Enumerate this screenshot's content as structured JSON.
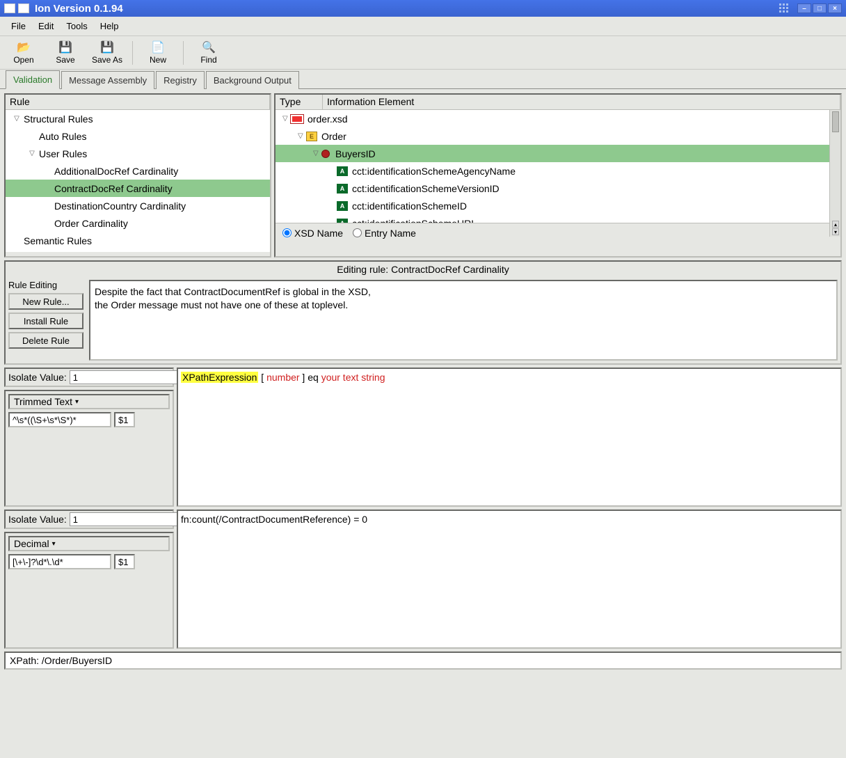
{
  "window": {
    "title": "Ion Version 0.1.94"
  },
  "menu": {
    "file": "File",
    "edit": "Edit",
    "tools": "Tools",
    "help": "Help"
  },
  "toolbar": {
    "open": "Open",
    "save": "Save",
    "saveas": "Save As",
    "new": "New",
    "find": "Find"
  },
  "tabs": [
    "Validation",
    "Message Assembly",
    "Registry",
    "Background Output"
  ],
  "rules": {
    "header": "Rule",
    "items": [
      {
        "label": "Structural Rules",
        "depth": 0,
        "expanded": true
      },
      {
        "label": "Auto Rules",
        "depth": 1
      },
      {
        "label": "User Rules",
        "depth": 1,
        "expanded": true
      },
      {
        "label": "AdditionalDocRef Cardinality",
        "depth": 2
      },
      {
        "label": "ContractDocRef Cardinality",
        "depth": 2,
        "selected": true
      },
      {
        "label": "DestinationCountry Cardinality",
        "depth": 2
      },
      {
        "label": "Order Cardinality",
        "depth": 2
      },
      {
        "label": "Semantic Rules",
        "depth": 0
      }
    ]
  },
  "types": {
    "type_header": "Type",
    "info_header": "Information Element",
    "items": [
      {
        "label": "order.xsd",
        "depth": 0,
        "expanded": true,
        "icon": "file"
      },
      {
        "label": "Order",
        "depth": 1,
        "expanded": true,
        "icon": "E"
      },
      {
        "label": "BuyersID",
        "depth": 2,
        "expanded": true,
        "icon": "dot",
        "selected": true
      },
      {
        "label": "cct:identificationSchemeAgencyName",
        "depth": 3,
        "icon": "A"
      },
      {
        "label": "cct:identificationSchemeVersionID",
        "depth": 3,
        "icon": "A"
      },
      {
        "label": "cct:identificationSchemeID",
        "depth": 3,
        "icon": "A"
      },
      {
        "label": "cct:identificationSchemeURI",
        "depth": 3,
        "icon": "A"
      }
    ],
    "radio": {
      "xsd": "XSD Name",
      "entry": "Entry Name"
    }
  },
  "edit": {
    "title": "Editing rule: ContractDocRef Cardinality",
    "panel_label": "Rule Editing",
    "new_rule": "New Rule...",
    "install_rule": "Install Rule",
    "delete_rule": "Delete Rule",
    "desc_l1": "Despite the fact that ContractDocumentRef is global in the XSD,",
    "desc_l2": "the Order message must not have one of these at toplevel."
  },
  "iso1": {
    "isolate_label": "Isolate Value:",
    "isolate_value": "1",
    "type": "Trimmed Text",
    "pattern": "^\\s*((\\S+\\s*\\S*)*",
    "replace": "$1"
  },
  "expr": {
    "xpath_label": "XPathExpression",
    "lbrack": " [ ",
    "number": "number",
    "rbrack": " ] eq ",
    "text": "your text string"
  },
  "iso2": {
    "isolate_label": "Isolate Value:",
    "isolate_value": "1",
    "type": "Decimal",
    "pattern": "[\\+\\-]?\\d*\\.\\d*",
    "replace": "$1"
  },
  "count_expr": "fn:count(/ContractDocumentReference) = 0",
  "xpath": "XPath: /Order/BuyersID"
}
